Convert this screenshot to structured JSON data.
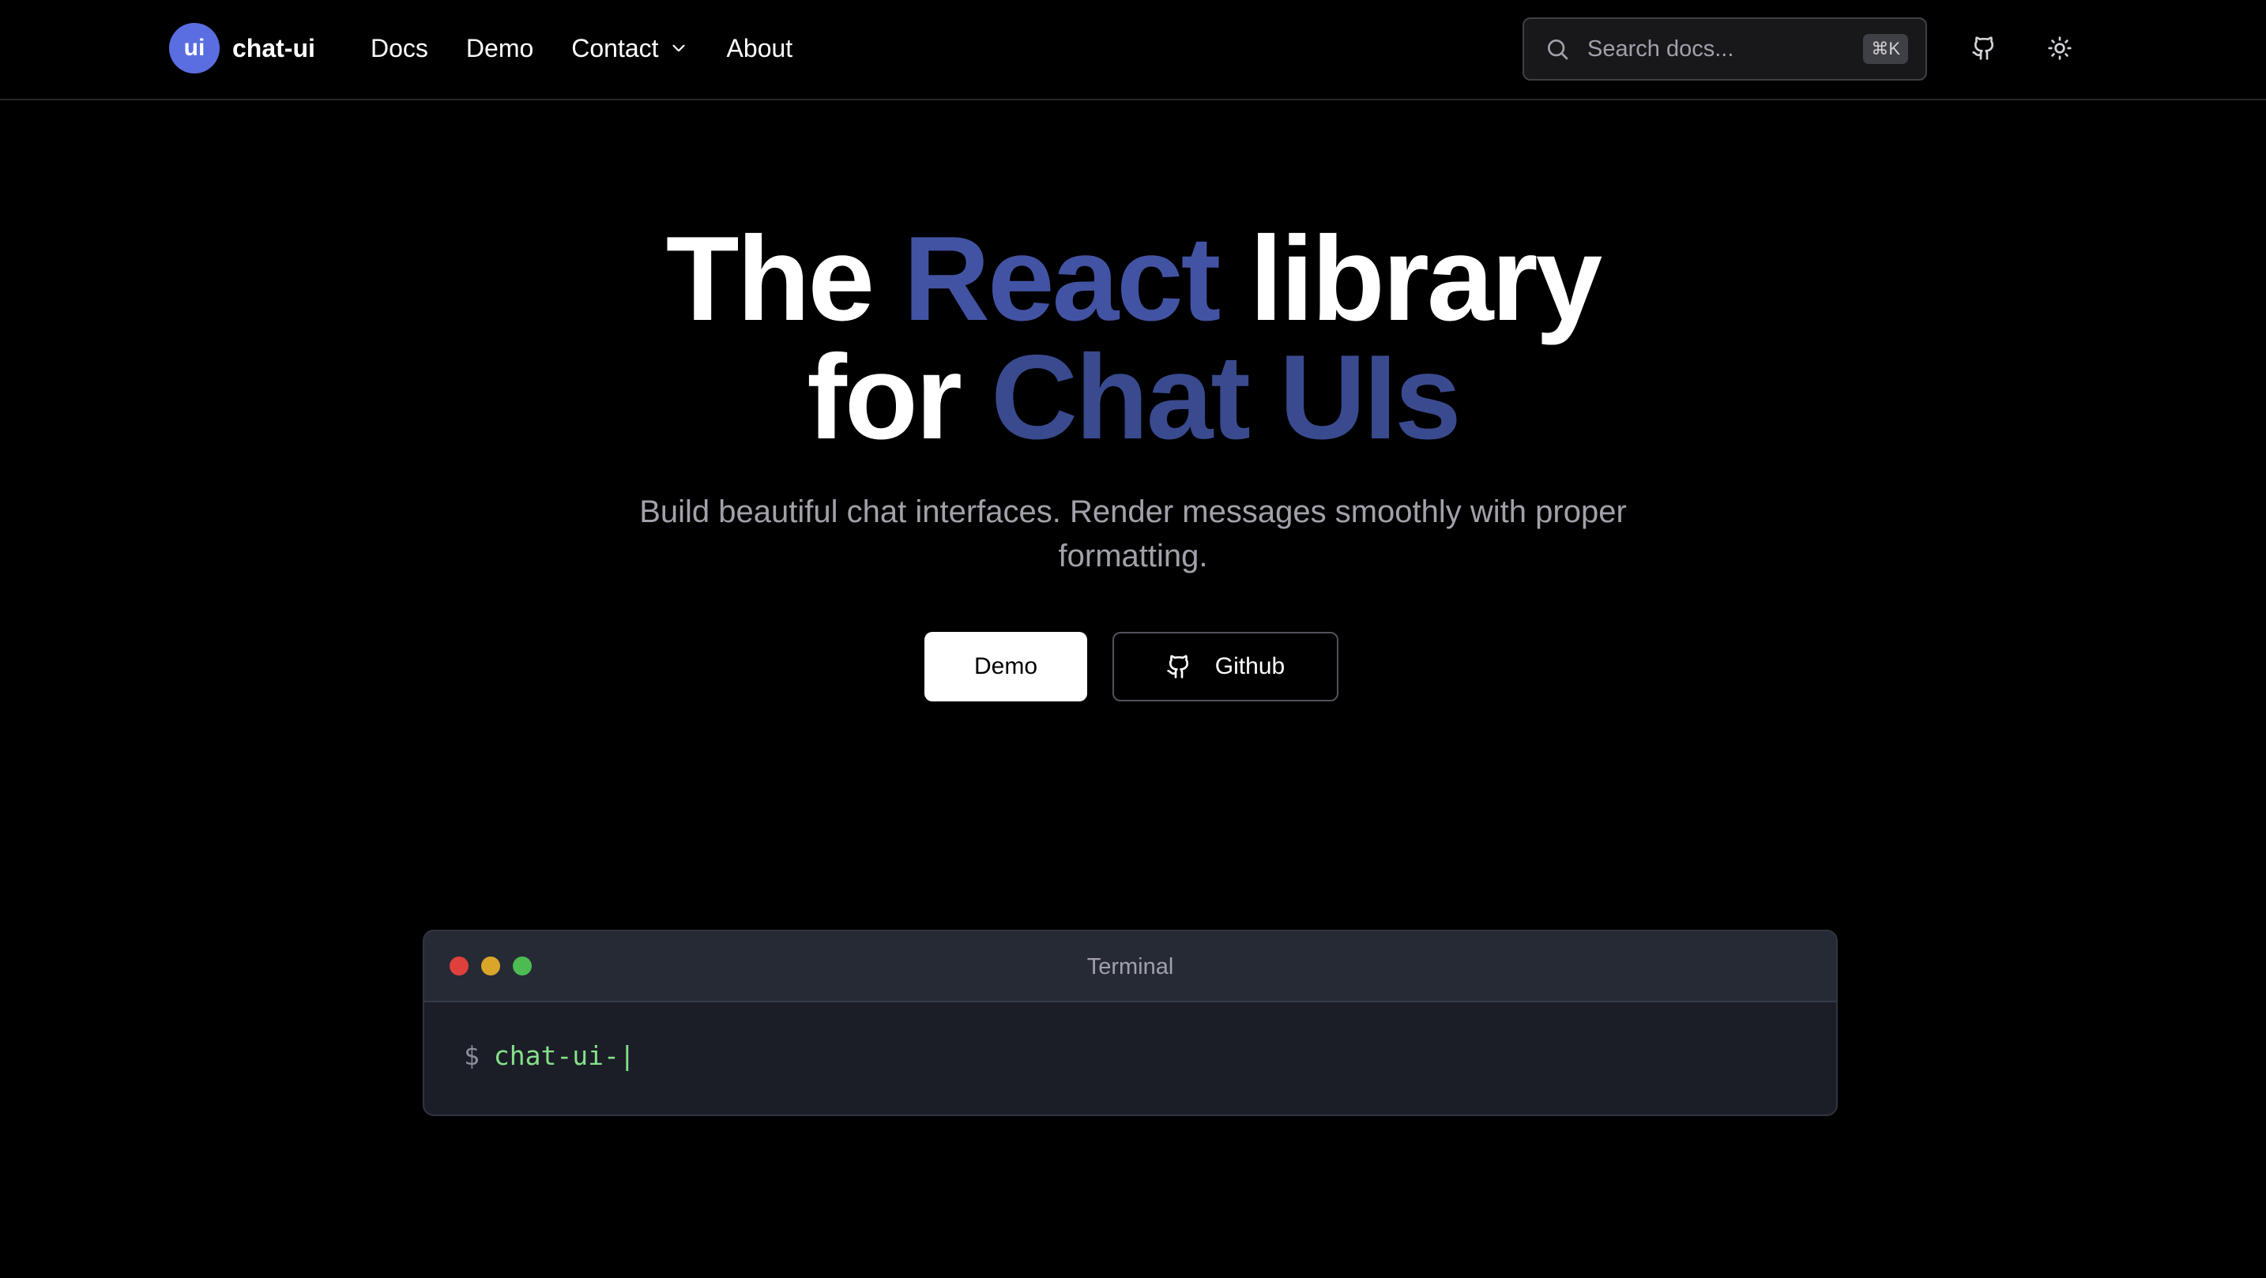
{
  "header": {
    "logo_text": "ui",
    "brand_name": "chat-ui",
    "nav": [
      {
        "label": "Docs"
      },
      {
        "label": "Demo"
      },
      {
        "label": "Contact"
      },
      {
        "label": "About"
      }
    ],
    "search": {
      "placeholder": "Search docs...",
      "shortcut": "⌘K"
    },
    "icons": {
      "github": "github-icon",
      "theme": "sun-icon"
    }
  },
  "hero": {
    "title": {
      "line1_part1": "The ",
      "line1_accent": "React",
      "line1_part2": " library",
      "line2_part1": "for ",
      "line2_accent": "Chat UIs"
    },
    "subtitle": "Build beautiful chat interfaces. Render messages smoothly with proper formatting.",
    "buttons": {
      "demo_label": "Demo",
      "github_label": "Github"
    }
  },
  "terminal": {
    "title": "Terminal",
    "prompt": "$",
    "command": "chat-ui-",
    "cursor": "|"
  },
  "colors": {
    "background": "#000000",
    "accent_react": "#4353a3",
    "accent_chatuis": "#3a4a8e",
    "logo_bg": "#5b6ee1",
    "terminal_command": "#86e08b",
    "dot_red": "#e0403c",
    "dot_yellow": "#d9a62a",
    "dot_green": "#4cbb51"
  }
}
